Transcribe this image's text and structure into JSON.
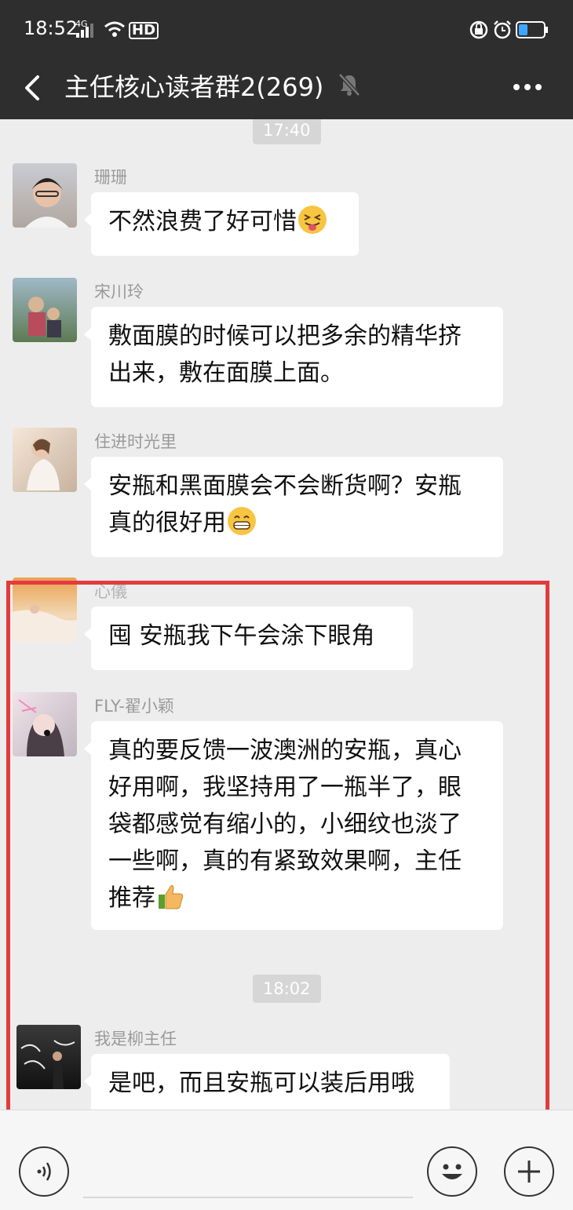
{
  "status_bar": {
    "time": "18:52",
    "signal_label": "4G",
    "hd_label": "HD",
    "battery_level": 0.35
  },
  "header": {
    "title": "主任核心读者群2(269)"
  },
  "timestamps": [
    "17:40",
    "18:02"
  ],
  "messages": [
    {
      "sender": "珊珊",
      "text": "不然浪费了好可惜",
      "emoji": "squinting-tongue-emoji"
    },
    {
      "sender": "宋川玲",
      "line1": "敷面膜的时候可以把多余的精华挤",
      "line2": "出来，敷在面膜上面。"
    },
    {
      "sender": "住进时光里",
      "line1": "安瓶和黑面膜会不会断货啊？安瓶",
      "line2": "真的很好用",
      "emoji": "grinning-emoji"
    },
    {
      "sender": "心儀",
      "text": "囤  安瓶我下午会涂下眼角"
    },
    {
      "sender": "FLY-翟小颖",
      "line1": "真的要反馈一波澳洲的安瓶，真心",
      "line2": "好用啊，我坚持用了一瓶半了，眼",
      "line3": "袋都感觉有缩小的，小细纹也淡了",
      "line4": "一些啊，真的有紧致效果啊，主任",
      "line5": "推荐",
      "emoji": "thumbs-up-emoji"
    },
    {
      "sender": "我是柳主任",
      "text": "是吧，而且安瓶可以装后用哦"
    }
  ],
  "colors": {
    "bar": "#2e2e2e",
    "chat_bg": "#ededed",
    "highlight": "#e23b3d",
    "bubble": "#ffffff"
  }
}
